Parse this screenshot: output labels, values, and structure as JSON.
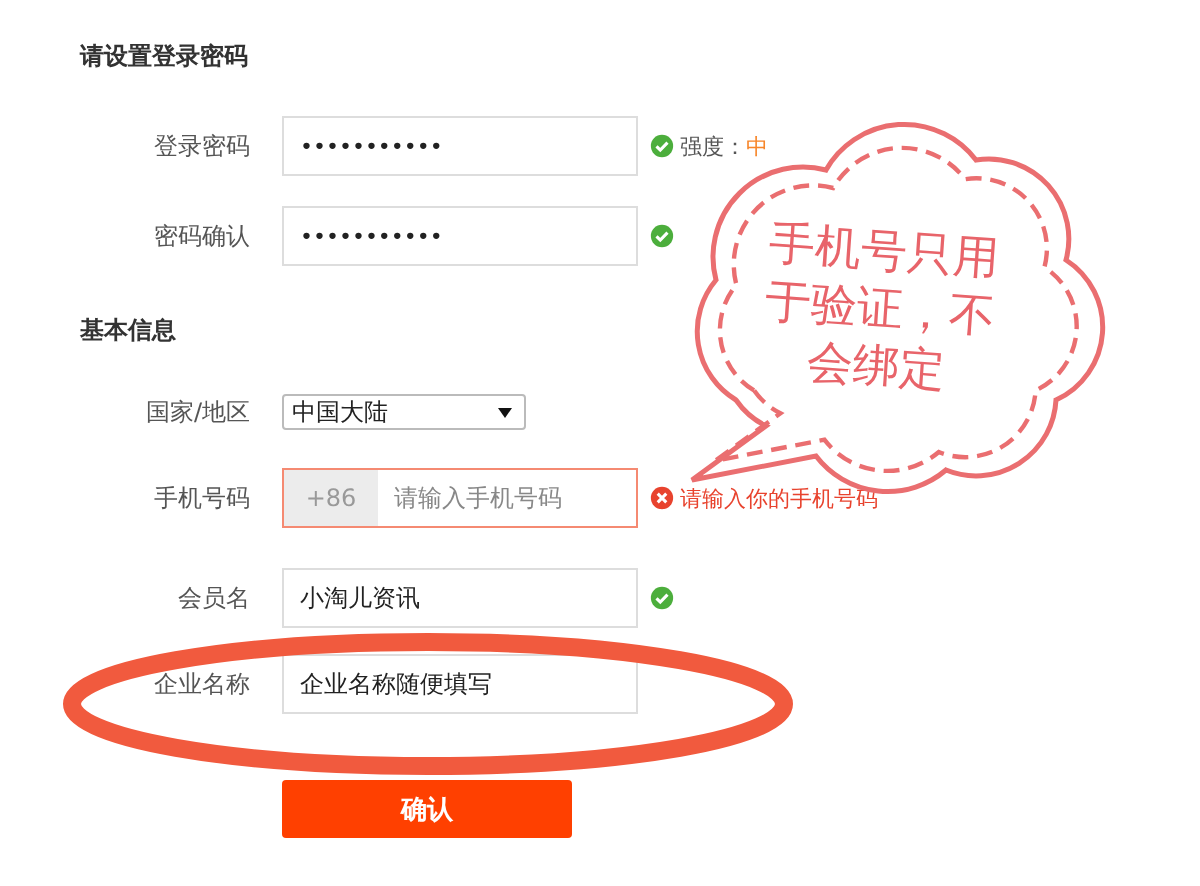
{
  "password_section": {
    "title": "请设置登录密码"
  },
  "password_fields": [
    {
      "label": "登录密码",
      "value": "•••••••••••",
      "valid": true,
      "strength_label": "强度：",
      "strength": "中"
    },
    {
      "label": "密码确认",
      "value": "•••••••••••",
      "valid": true
    }
  ],
  "basic_section": {
    "title": "基本信息"
  },
  "country": {
    "label": "国家/地区",
    "value": "中国大陆"
  },
  "phone": {
    "label": "手机号码",
    "prefix": "+86",
    "placeholder": "请输入手机号码",
    "valid": false,
    "error": "请输入你的手机号码"
  },
  "member": {
    "label": "会员名",
    "value": "小淘儿资讯",
    "valid": true
  },
  "company": {
    "label": "企业名称",
    "value": "企业名称随便填写",
    "circled": true
  },
  "confirm_button": "确认",
  "callout": {
    "text": "手机号只用于验证，不会绑定"
  }
}
